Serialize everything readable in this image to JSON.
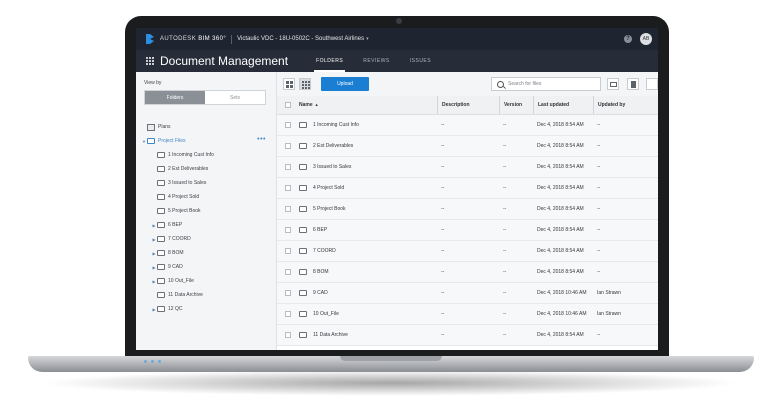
{
  "nav": {
    "brand_prefix": "AUTODESK",
    "brand_product": "BIM 360°",
    "project": "Victaulic VDC - 18U-0502C - Southwest Airlines",
    "avatar_initials": "AB"
  },
  "module": {
    "title": "Document Management",
    "tabs": [
      {
        "label": "FOLDERS",
        "active": true
      },
      {
        "label": "REVIEWS",
        "active": false
      },
      {
        "label": "ISSUES",
        "active": false
      }
    ]
  },
  "left": {
    "view_by_label": "View by",
    "toggle": {
      "folders": "Folders",
      "sets": "Sets"
    },
    "plans_label": "Plans",
    "project_files_label": "Project Files",
    "tree": [
      {
        "label": "1 Incoming Cust Info",
        "expandable": false
      },
      {
        "label": "2 Est Deliverables",
        "expandable": false
      },
      {
        "label": "3 Issued to Sales",
        "expandable": false
      },
      {
        "label": "4 Project Sold",
        "expandable": false
      },
      {
        "label": "5 Project Book",
        "expandable": false
      },
      {
        "label": "6 BEP",
        "expandable": true
      },
      {
        "label": "7 COORD",
        "expandable": true
      },
      {
        "label": "8 BOM",
        "expandable": true
      },
      {
        "label": "9 CAD",
        "expandable": true
      },
      {
        "label": "10 Out_File",
        "expandable": true
      },
      {
        "label": "11 Data Archive",
        "expandable": false
      },
      {
        "label": "12 QC",
        "expandable": true
      }
    ]
  },
  "toolbar": {
    "upload_label": "Upload",
    "search_placeholder": "Search for files"
  },
  "table": {
    "headers": {
      "name": "Name",
      "description": "Description",
      "version": "Version",
      "last_updated": "Last updated",
      "updated_by": "Updated by"
    },
    "rows": [
      {
        "name": "1 Incoming Cust Info",
        "description": "--",
        "version": "--",
        "updated": "Dec 4, 2018 8:54 AM",
        "by": "--"
      },
      {
        "name": "2 Est Deliverables",
        "description": "--",
        "version": "--",
        "updated": "Dec 4, 2018 8:54 AM",
        "by": "--"
      },
      {
        "name": "3 Issued to Sales",
        "description": "--",
        "version": "--",
        "updated": "Dec 4, 2018 8:54 AM",
        "by": "--"
      },
      {
        "name": "4 Project Sold",
        "description": "--",
        "version": "--",
        "updated": "Dec 4, 2018 8:54 AM",
        "by": "--"
      },
      {
        "name": "5 Project Book",
        "description": "--",
        "version": "--",
        "updated": "Dec 4, 2018 8:54 AM",
        "by": "--"
      },
      {
        "name": "6 BEP",
        "description": "--",
        "version": "--",
        "updated": "Dec 4, 2018 8:54 AM",
        "by": "--"
      },
      {
        "name": "7 COORD",
        "description": "--",
        "version": "--",
        "updated": "Dec 4, 2018 8:54 AM",
        "by": "--"
      },
      {
        "name": "8 BOM",
        "description": "--",
        "version": "--",
        "updated": "Dec 4, 2018 8:54 AM",
        "by": "--"
      },
      {
        "name": "9 CAD",
        "description": "--",
        "version": "--",
        "updated": "Dec 4, 2018 10:46 AM",
        "by": "Ian Strawn"
      },
      {
        "name": "10 Out_File",
        "description": "--",
        "version": "--",
        "updated": "Dec 4, 2018 10:46 AM",
        "by": "Ian Strawn"
      },
      {
        "name": "11 Data Archive",
        "description": "--",
        "version": "--",
        "updated": "Dec 4, 2018 8:54 AM",
        "by": "--"
      }
    ]
  }
}
